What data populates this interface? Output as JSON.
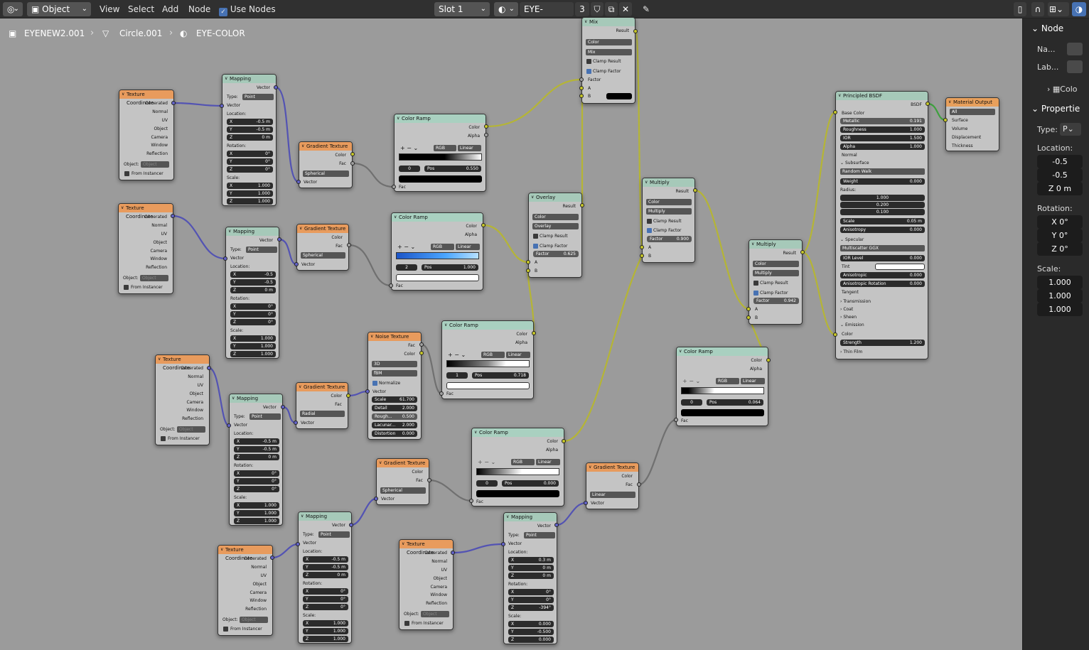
{
  "header": {
    "mode": "Object",
    "menus": [
      "View",
      "Select",
      "Add",
      "Node"
    ],
    "use_nodes": "Use Nodes",
    "slot": "Slot 1",
    "material_name": "EYE-COLOR",
    "user_count": "3"
  },
  "breadcrumb": {
    "object": "EYENEW2.001",
    "mesh": "Circle.001",
    "material": "EYE-COLOR"
  },
  "sidebar": {
    "node_section": "Node",
    "name_label": "Na...",
    "label_label": "Lab...",
    "color_label": "Colo",
    "properties_section": "Propertie",
    "type_label": "Type:",
    "type_value": "P",
    "location_label": "Location:",
    "location": [
      "-0.5",
      "-0.5",
      "Z  0 m"
    ],
    "rotation_label": "Rotation:",
    "rotation": [
      "X    0°",
      "Y    0°",
      "Z    0°"
    ],
    "scale_label": "Scale:",
    "scale": [
      "1.000",
      "1.000",
      "1.000"
    ]
  },
  "nodes": {
    "texcoord": {
      "title": "Texture Coordinate",
      "outputs": [
        "Generated",
        "Normal",
        "UV",
        "Object",
        "Camera",
        "Window",
        "Reflection"
      ],
      "object_label": "Object:",
      "object_placeholder": "Object",
      "from_instancer": "From Instancer"
    },
    "mapping": {
      "title": "Mapping",
      "vector": "Vector",
      "type_label": "Type:",
      "type_value": "Point",
      "location": "Location:",
      "rotation": "Rotation:",
      "scale": "Scale:"
    },
    "mapping_values": {
      "m1": {
        "loc": [
          "-0.5 m",
          "-0.5 m",
          "0 m"
        ],
        "rot": [
          "0°",
          "0°",
          "0°"
        ],
        "scale": [
          "1.000",
          "1.000",
          "1.000"
        ]
      },
      "m2": {
        "loc": [
          "-0.5",
          "-0.5",
          "0 m"
        ],
        "rot": [
          "0°",
          "0°",
          "0°"
        ],
        "scale": [
          "1.000",
          "1.000",
          "1.000"
        ]
      },
      "m3": {
        "loc": [
          "-0.5 m",
          "-0.5 m",
          "0 m"
        ],
        "rot": [
          "0°",
          "0°",
          "0°"
        ],
        "scale": [
          "1.000",
          "1.000",
          "1.000"
        ]
      },
      "m4": {
        "loc": [
          "-0.5 m",
          "-0.5 m",
          "0 m"
        ],
        "rot": [
          "0°",
          "0°",
          "0°"
        ],
        "scale": [
          "1.000",
          "1.000",
          "1.000"
        ]
      },
      "m5": {
        "loc": [
          "0.3 m",
          "0 m",
          "0 m"
        ],
        "rot": [
          "0°",
          "0°",
          "-394°"
        ],
        "scale": [
          "0.000",
          "-0.500",
          "0.000"
        ]
      }
    },
    "gradient": {
      "title": "Gradient Texture",
      "color": "Color",
      "fac": "Fac",
      "vector": "Vector",
      "g1": "Spherical",
      "g2": "Spherical",
      "g3": "Radial",
      "g4": "Spherical",
      "g5": "Linear"
    },
    "ramp": {
      "title": "Color Ramp",
      "color": "Color",
      "alpha": "Alpha",
      "fac": "Fac",
      "mode": "RGB",
      "interp": "Linear",
      "pos_label": "Pos",
      "r1": {
        "index": "0",
        "pos": "0.550"
      },
      "r2": {
        "index": "2",
        "pos": "1.000"
      },
      "r3": {
        "index": "1",
        "pos": "0.718"
      },
      "r4": {
        "index": "0",
        "pos": "0.000"
      },
      "r5": {
        "index": "0",
        "pos": "0.064"
      }
    },
    "noise": {
      "title": "Noise Texture",
      "fac": "Fac",
      "color": "Color",
      "dim": "3D",
      "type": "fBM",
      "normalize": "Normalize",
      "vector": "Vector",
      "fields": [
        {
          "label": "Scale",
          "value": "61.700"
        },
        {
          "label": "Detail",
          "value": "2.000"
        },
        {
          "label": "Rough...",
          "value": "0.500"
        },
        {
          "label": "Lacunar...",
          "value": "2.000"
        },
        {
          "label": "Distortion",
          "value": "0.000"
        }
      ]
    },
    "mix": {
      "title": "Mix",
      "result": "Result",
      "type": "Color",
      "blend": "Mix",
      "clamp_result": "Clamp Result",
      "clamp_factor": "Clamp Factor",
      "factor": "Factor",
      "a": "A",
      "b": "B"
    },
    "overlay": {
      "title": "Overlay",
      "result": "Result",
      "type": "Color",
      "blend": "Overlay",
      "clamp_result": "Clamp Result",
      "clamp_factor": "Clamp Factor",
      "factor": "Factor",
      "factor_value": "0.625",
      "a": "A",
      "b": "B"
    },
    "multiply1": {
      "title": "Multiply",
      "result": "Result",
      "type": "Color",
      "blend": "Multiply",
      "clamp_result": "Clamp Result",
      "clamp_factor": "Clamp Factor",
      "factor": "Factor",
      "factor_value": "0.900",
      "a": "A",
      "b": "B"
    },
    "multiply2": {
      "title": "Multiply",
      "result": "Result",
      "type": "Color",
      "blend": "Multiply",
      "clamp_result": "Clamp Result",
      "clamp_factor": "Clamp Factor",
      "factor": "Factor",
      "factor_value": "0.942",
      "a": "A",
      "b": "B"
    },
    "bsdf": {
      "title": "Principled BSDF",
      "bsdf": "BSDF",
      "base_color": "Base Color",
      "metallic": "Metallic",
      "metallic_v": "0.191",
      "roughness": "Roughness",
      "roughness_v": "1.000",
      "ior": "IOR",
      "ior_v": "1.500",
      "alpha": "Alpha",
      "alpha_v": "1.000",
      "normal": "Normal",
      "subsurface": "Subsurface",
      "random_walk": "Random Walk",
      "weight": "Weight",
      "weight_v": "0.000",
      "radius": "Radius:",
      "radius_v": [
        "1.000",
        "0.200",
        "0.100"
      ],
      "scale": "Scale",
      "scale_v": "0.05 m",
      "anisotropy": "Anisotropy",
      "anisotropy_v": "0.000",
      "specular": "Specular",
      "multiscatter": "Multiscatter GGX",
      "ior_level": "IOR Level",
      "ior_level_v": "0.000",
      "tint": "Tint",
      "anisotropic": "Anisotropic",
      "anisotropic_v": "0.000",
      "aniso_rot": "Anisotropic Rotation",
      "aniso_rot_v": "0.000",
      "tangent": "Tangent",
      "transmission": "Transmission",
      "coat": "Coat",
      "sheen": "Sheen",
      "emission": "Emission",
      "color": "Color",
      "strength": "Strength",
      "strength_v": "1.200",
      "thin_film": "Thin Film"
    },
    "output": {
      "title": "Material Output",
      "target": "All",
      "inputs": [
        "Surface",
        "Volume",
        "Displacement",
        "Thickness"
      ]
    }
  }
}
